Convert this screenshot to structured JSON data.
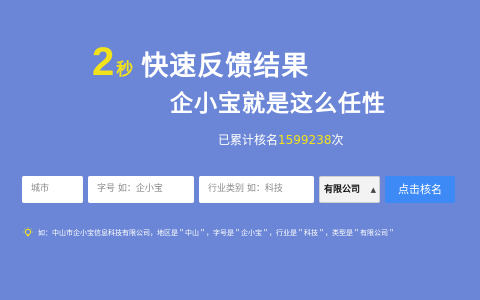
{
  "hero": {
    "seconds": "2",
    "seconds_unit": "秒",
    "slogan_line1": "快速反馈结果",
    "slogan_line2": "企小宝就是这么任性"
  },
  "counter": {
    "prefix": "已累计核名",
    "count": "1599238",
    "suffix": "次"
  },
  "form": {
    "city_placeholder": "城市",
    "name_placeholder": "字号 如：企小宝",
    "industry_placeholder": "行业类别 如：科技",
    "company_type_value": "有限公司",
    "submit_label": "点击核名"
  },
  "example": {
    "text": "如：中山市企小宝信息科技有限公司，地区是＂中山＂，字号是＂企小宝＂，行业是＂科技＂，类型是＂有限公司＂"
  },
  "colors": {
    "background": "#6b86d6",
    "accent_yellow": "#f2e21b",
    "button_blue": "#3d8af7"
  }
}
